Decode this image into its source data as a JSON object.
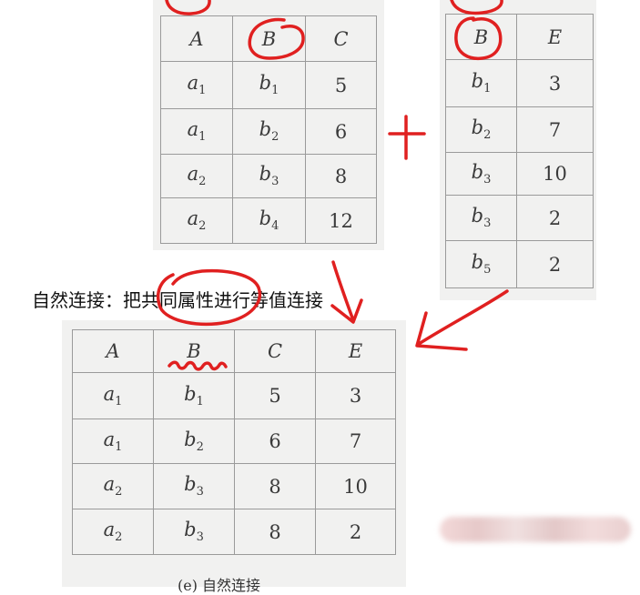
{
  "table_r": {
    "headers": [
      "A",
      "B",
      "C"
    ],
    "rows": [
      {
        "a": "a",
        "as": "1",
        "b": "b",
        "bs": "1",
        "c": "5"
      },
      {
        "a": "a",
        "as": "1",
        "b": "b",
        "bs": "2",
        "c": "6"
      },
      {
        "a": "a",
        "as": "2",
        "b": "b",
        "bs": "3",
        "c": "8"
      },
      {
        "a": "a",
        "as": "2",
        "b": "b",
        "bs": "4",
        "c": "12"
      }
    ]
  },
  "table_s": {
    "headers": [
      "B",
      "E"
    ],
    "rows": [
      {
        "b": "b",
        "bs": "1",
        "e": "3"
      },
      {
        "b": "b",
        "bs": "2",
        "e": "7"
      },
      {
        "b": "b",
        "bs": "3",
        "e": "10"
      },
      {
        "b": "b",
        "bs": "3",
        "e": "2"
      },
      {
        "b": "b",
        "bs": "5",
        "e": "2"
      }
    ]
  },
  "table_result": {
    "headers": [
      "A",
      "B",
      "C",
      "E"
    ],
    "rows": [
      {
        "a": "a",
        "as": "1",
        "b": "b",
        "bs": "1",
        "c": "5",
        "e": "3"
      },
      {
        "a": "a",
        "as": "1",
        "b": "b",
        "bs": "2",
        "c": "6",
        "e": "7"
      },
      {
        "a": "a",
        "as": "2",
        "b": "b",
        "bs": "3",
        "c": "8",
        "e": "10"
      },
      {
        "a": "a",
        "as": "2",
        "b": "b",
        "bs": "3",
        "c": "8",
        "e": "2"
      }
    ]
  },
  "note": "自然连接：把共同属性进行等值连接",
  "caption": "(e) 自然连接",
  "colors": {
    "annotation": "#e02020",
    "panel": "#f1f1f0",
    "grid": "#9a9a9a"
  }
}
